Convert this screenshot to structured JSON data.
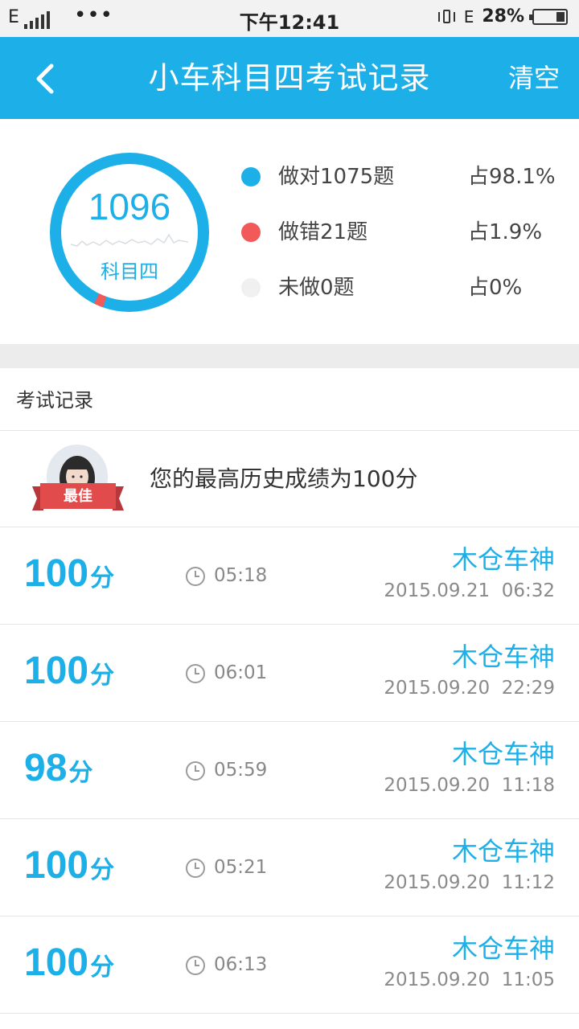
{
  "status_bar": {
    "network_left": "E",
    "time": "下午12:41",
    "network_right": "E",
    "battery": "28%",
    "battery_level": 0.28
  },
  "header": {
    "title": "小车科目四考试记录",
    "clear_label": "清空"
  },
  "stats": {
    "total": "1096",
    "subject": "科目四",
    "correct_fraction": 0.981,
    "wrong_fraction": 0.019,
    "items": [
      {
        "label": "做对1075题",
        "pct": "占98.1%",
        "color": "#1db0e8"
      },
      {
        "label": "做错21题",
        "pct": "占1.9%",
        "color": "#f25a5a"
      },
      {
        "label": "未做0题",
        "pct": "占0%",
        "color": "#f0f0f0"
      }
    ]
  },
  "records_section": {
    "title": "考试记录",
    "best_badge": "最佳",
    "best_text": "您的最高历史成绩为100分"
  },
  "records": [
    {
      "score": "100",
      "unit": "分",
      "duration": "05:18",
      "user": "木仓车神",
      "datetime": "2015.09.21  06:32"
    },
    {
      "score": "100",
      "unit": "分",
      "duration": "06:01",
      "user": "木仓车神",
      "datetime": "2015.09.20  22:29"
    },
    {
      "score": "98",
      "unit": "分",
      "duration": "05:59",
      "user": "木仓车神",
      "datetime": "2015.09.20  11:18"
    },
    {
      "score": "100",
      "unit": "分",
      "duration": "05:21",
      "user": "木仓车神",
      "datetime": "2015.09.20  11:12"
    },
    {
      "score": "100",
      "unit": "分",
      "duration": "06:13",
      "user": "木仓车神",
      "datetime": "2015.09.20  11:05"
    }
  ]
}
